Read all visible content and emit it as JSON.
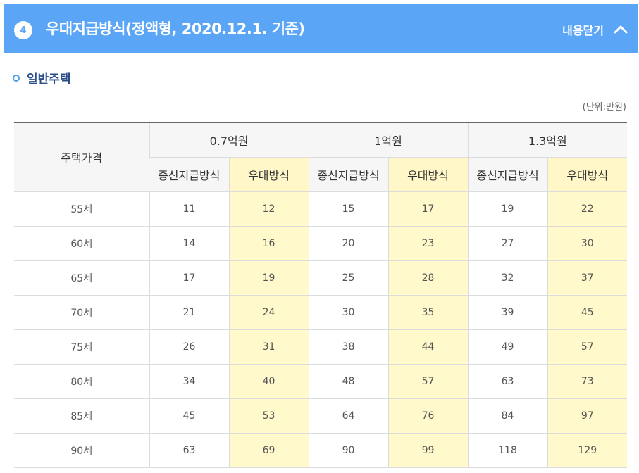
{
  "header": {
    "step_number": "4",
    "title": "우대지급방식(정액형, 2020.12.1. 기준)",
    "collapse_label": "내용닫기",
    "background_color": "#5aa5f6"
  },
  "section": {
    "title": "일반주택",
    "unit_note": "(단위:만원)"
  },
  "table": {
    "row_header": "주택가격",
    "price_groups": [
      "0.7억원",
      "1억원",
      "1.3억원"
    ],
    "sub_headers": [
      "종신지급방식",
      "우대방식",
      "종신지급방식",
      "우대방식",
      "종신지급방식",
      "우대방식"
    ],
    "highlight_color": "#fff9cc",
    "rows": [
      {
        "age": "55세",
        "values": [
          "11",
          "12",
          "15",
          "17",
          "19",
          "22"
        ]
      },
      {
        "age": "60세",
        "values": [
          "14",
          "16",
          "20",
          "23",
          "27",
          "30"
        ]
      },
      {
        "age": "65세",
        "values": [
          "17",
          "19",
          "25",
          "28",
          "32",
          "37"
        ]
      },
      {
        "age": "70세",
        "values": [
          "21",
          "24",
          "30",
          "35",
          "39",
          "45"
        ]
      },
      {
        "age": "75세",
        "values": [
          "26",
          "31",
          "38",
          "44",
          "49",
          "57"
        ]
      },
      {
        "age": "80세",
        "values": [
          "34",
          "40",
          "48",
          "57",
          "63",
          "73"
        ]
      },
      {
        "age": "85세",
        "values": [
          "45",
          "53",
          "64",
          "76",
          "84",
          "97"
        ]
      },
      {
        "age": "90세",
        "values": [
          "63",
          "69",
          "90",
          "99",
          "118",
          "129"
        ]
      }
    ]
  }
}
